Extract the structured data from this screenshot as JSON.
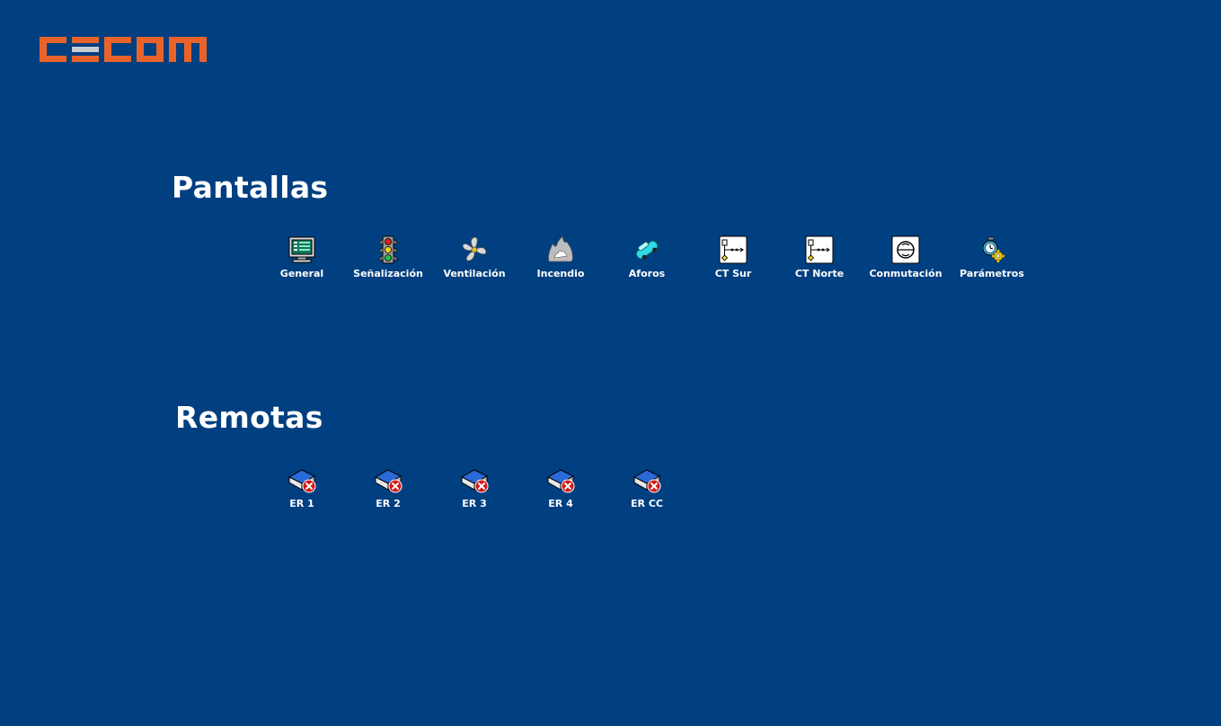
{
  "brand": {
    "logo_text": "CECOM",
    "logo_color": "#e8632a",
    "bar_color": "#c9ccd3"
  },
  "colors": {
    "background": "#003f80",
    "text": "#ffffff"
  },
  "pantallas": {
    "title": "Pantallas",
    "items": [
      {
        "label": "General",
        "icon": "monitor-icon"
      },
      {
        "label": "Señalización",
        "icon": "traffic-light-icon"
      },
      {
        "label": "Ventilación",
        "icon": "fan-icon"
      },
      {
        "label": "Incendio",
        "icon": "fire-icon"
      },
      {
        "label": "Aforos",
        "icon": "car-icon"
      },
      {
        "label": "CT Sur",
        "icon": "electrical-diagram-icon"
      },
      {
        "label": "CT Norte",
        "icon": "electrical-diagram-icon"
      },
      {
        "label": "Conmutación",
        "icon": "switch-icon"
      },
      {
        "label": "Parámetros",
        "icon": "stopwatch-gear-icon"
      }
    ]
  },
  "remotas": {
    "title": "Remotas",
    "items": [
      {
        "label": "ER 1",
        "icon": "remote-station-error-icon"
      },
      {
        "label": "ER 2",
        "icon": "remote-station-error-icon"
      },
      {
        "label": "ER 3",
        "icon": "remote-station-error-icon"
      },
      {
        "label": "ER 4",
        "icon": "remote-station-error-icon"
      },
      {
        "label": "ER CC",
        "icon": "remote-station-error-icon"
      }
    ]
  }
}
